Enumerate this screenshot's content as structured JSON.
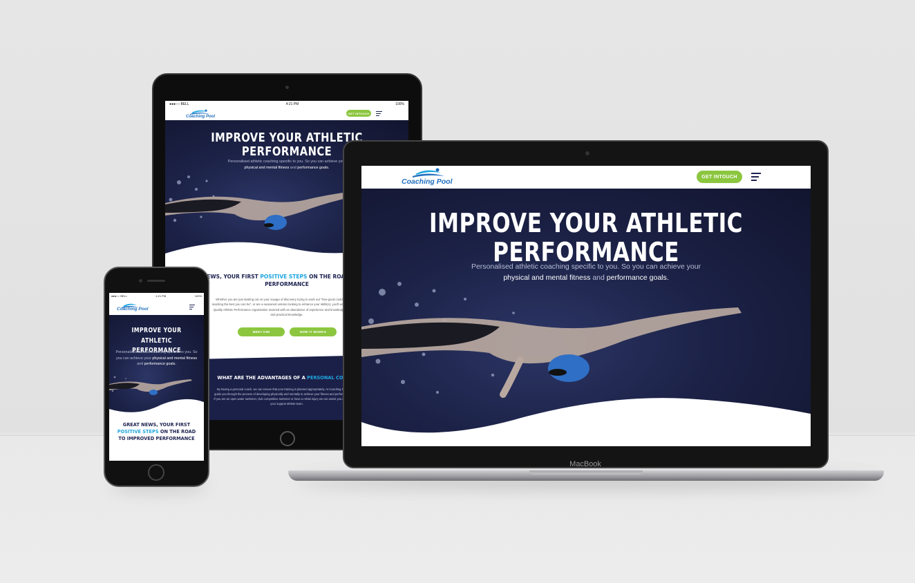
{
  "brand": {
    "logo_text": "Coaching Pool",
    "device_label": "MacBook"
  },
  "colors": {
    "accent_green": "#8cc63f",
    "accent_blue": "#1fa6e0",
    "hero_navy": "#1c2247"
  },
  "status_bar": {
    "carrier": "●●●○○ BELL",
    "time": "4:21 PM",
    "battery": "100%"
  },
  "header": {
    "cta_label": "GET INTOUCH",
    "menu_icon": "menu-icon"
  },
  "hero": {
    "title_line1": "IMPROVE YOUR ATHLETIC",
    "title_line2": "PERFORMANCE",
    "sub_plain1": "Personalised athletic coaching specific to you. So you can achieve your",
    "sub_bold1": "physical and mental fitness",
    "sub_and": "and",
    "sub_bold2": "performance goals."
  },
  "news": {
    "heading_a": "GREAT NEWS, YOUR FIRST",
    "heading_highlight": "POSITIVE STEPS",
    "heading_b": "ON THE ROAD TO IMPROVED PERFORMANCE",
    "body": "Whether you are just starting out on your voyage of discovery trying to work out \"how good could I be\", \"am I reaching the best you can be\", or are a seasoned veteran looking to enhance your skills(s), you'll want access to a Quality Athletic Performance organisation manned with an abundance of experience and knowledge both theory and practical knowledge.",
    "button_meet": "MEET KIM",
    "button_how": "HOW IT WORKS"
  },
  "advantages": {
    "heading_a": "WHAT ARE THE ADVANTAGES OF A",
    "heading_highlight": "PERSONAL COACH?",
    "body": "By having a personal coach, we can ensure that your training is planned appropriately. At Coaching Pool we will guide you through the process of developing physically and mentally to achieve your fitness and performance goals. If you are an open water swimmer, club competitive swimmer or have a rehab injury we can assist you and be part of your support athlete team."
  }
}
